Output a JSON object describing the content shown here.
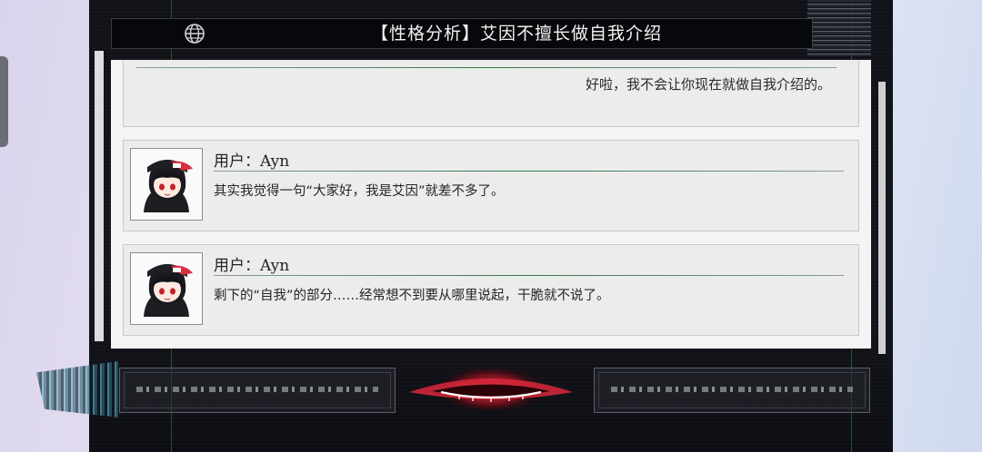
{
  "header": {
    "title": "【性格分析】艾因不擅长做自我介绍",
    "globe_icon": "globe-icon"
  },
  "log": {
    "first_entry_text": "好啦，我不会让你现在就做自我介绍的。",
    "entries": [
      {
        "speaker": "用户：Ayn",
        "message": "其实我觉得一句“大家好，我是艾因”就差不多了。",
        "avatar_icon": "chibi-avatar"
      },
      {
        "speaker": "用户：Ayn",
        "message": "剩下的“自我”的部分……经常想不到要从哪里说起，干脆就不说了。",
        "avatar_icon": "chibi-avatar"
      }
    ]
  },
  "colors": {
    "frame": "#101116",
    "accent_green": "#2f7a4a",
    "emblem_red": "#d8283a"
  }
}
